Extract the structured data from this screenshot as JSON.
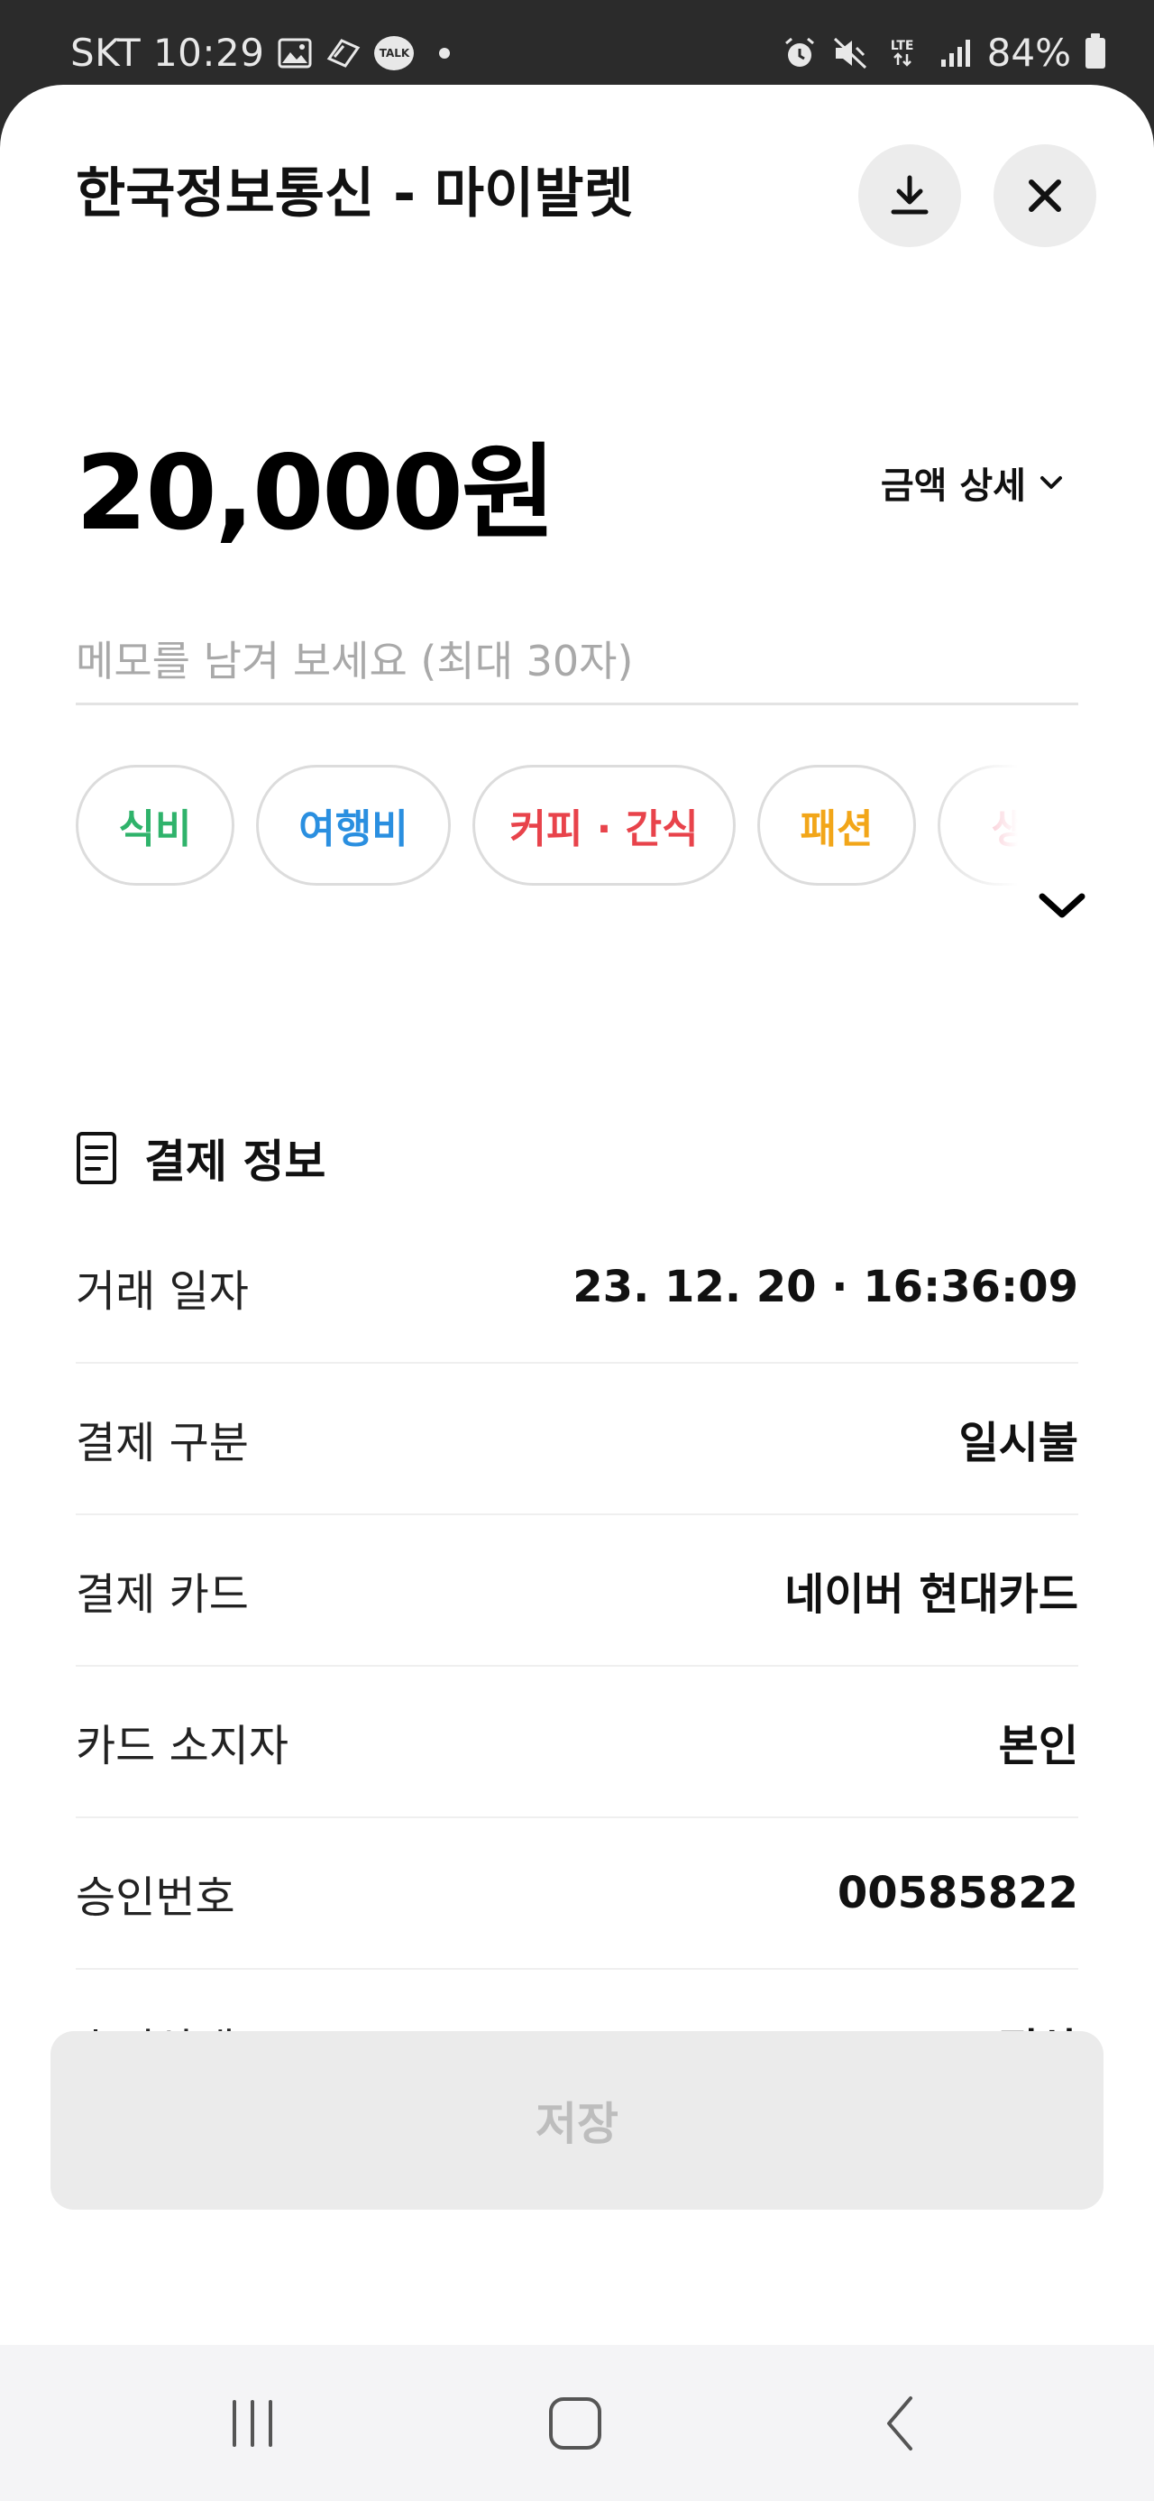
{
  "status_bar": {
    "carrier_time": "SKT 10:29",
    "network": "LTE",
    "battery": "84%",
    "icons": [
      "gallery-icon",
      "screenshot-icon",
      "kakaotalk-icon",
      "dot-icon",
      "alarm-icon",
      "mute-icon",
      "lte-icon",
      "signal-icon",
      "battery-icon"
    ],
    "talk_label": "TALK"
  },
  "header": {
    "title": "한국정보통신 - 마이발렛",
    "download_icon": "download-icon",
    "close_icon": "close-icon"
  },
  "amount": {
    "value": "20,000원",
    "detail_label": "금액 상세"
  },
  "memo": {
    "placeholder": "메모를 남겨 보세요 (최대 30자)",
    "value": ""
  },
  "categories": [
    {
      "label": "식비",
      "color": "#2fb36b"
    },
    {
      "label": "여행비",
      "color": "#2a8fe0"
    },
    {
      "label": "커피 · 간식",
      "color": "#e8434b"
    },
    {
      "label": "패션",
      "color": "#f2a619"
    },
    {
      "label": "생활",
      "color": "#f06b86"
    }
  ],
  "payment_info": {
    "title": "결제 정보",
    "rows": [
      {
        "label": "거래 일자",
        "value": "23. 12. 20  ·  16:36:09"
      },
      {
        "label": "결제 구분",
        "value": "일시불"
      },
      {
        "label": "결제 카드",
        "value": "네이버 현대카드"
      },
      {
        "label": "카드 소지자",
        "value": "본인"
      },
      {
        "label": "승인번호",
        "value": "00585822"
      },
      {
        "label": "승인상태",
        "value": "정상"
      }
    ]
  },
  "save_button": {
    "label": "저장"
  },
  "nav": {
    "recents_icon": "recents-icon",
    "home_icon": "home-icon",
    "back_icon": "back-icon"
  }
}
